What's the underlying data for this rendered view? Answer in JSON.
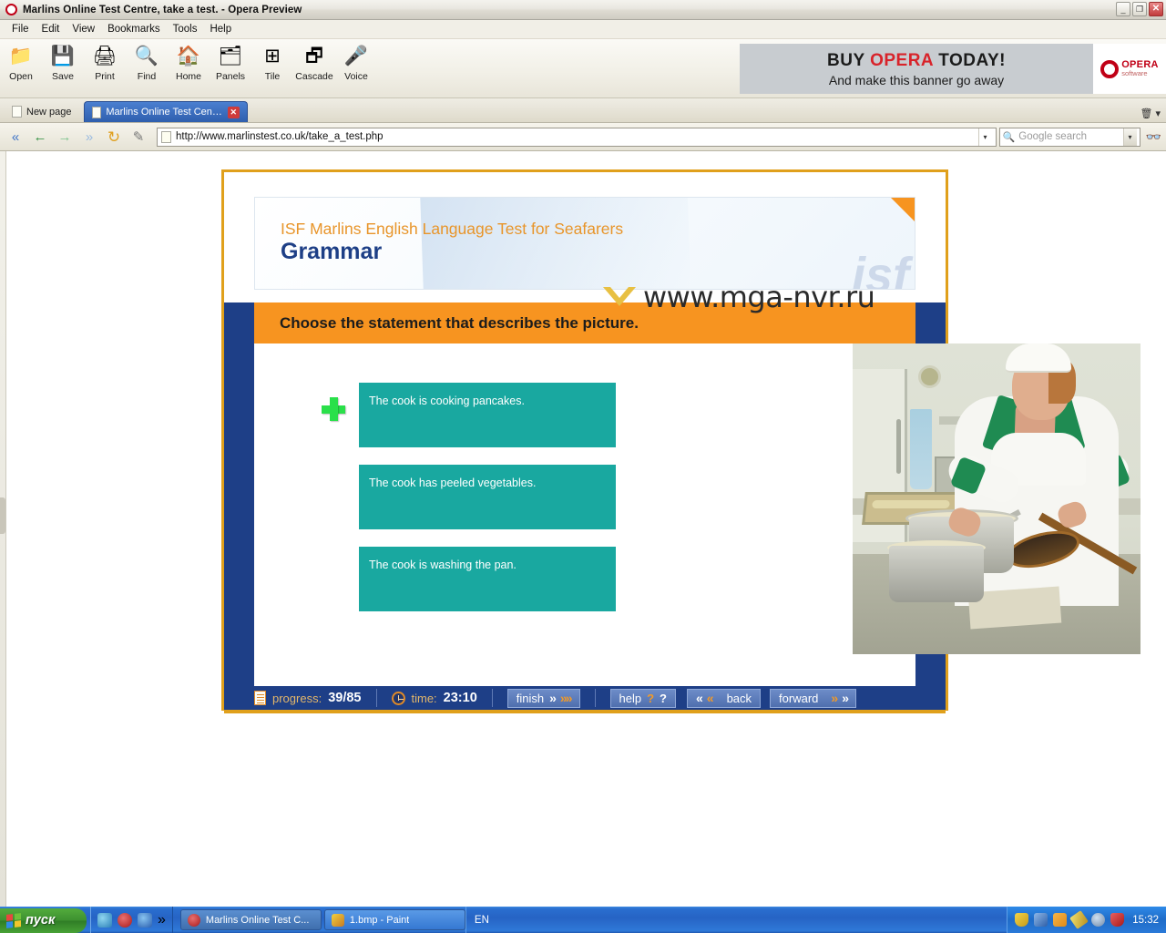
{
  "window": {
    "title": "Marlins Online Test Centre, take a test. - Opera Preview",
    "app_icon": "opera-icon",
    "minimize": "_",
    "restore": "❐",
    "close": "✕"
  },
  "menubar": {
    "items": [
      "File",
      "Edit",
      "View",
      "Bookmarks",
      "Tools",
      "Help"
    ]
  },
  "toolbar": {
    "buttons": [
      {
        "label": "Open",
        "icon": "folder-icon",
        "glyph": "📁"
      },
      {
        "label": "Save",
        "icon": "floppy-icon",
        "glyph": "💾"
      },
      {
        "label": "Print",
        "icon": "printer-icon",
        "glyph": "🖨"
      },
      {
        "label": "Find",
        "icon": "magnifier-icon",
        "glyph": "🔍"
      },
      {
        "label": "Home",
        "icon": "home-icon",
        "glyph": "🏠"
      },
      {
        "label": "Panels",
        "icon": "panels-icon",
        "glyph": "🗂"
      },
      {
        "label": "Tile",
        "icon": "tile-icon",
        "glyph": "⊞"
      },
      {
        "label": "Cascade",
        "icon": "cascade-icon",
        "glyph": "🗗"
      },
      {
        "label": "Voice",
        "icon": "voice-icon",
        "glyph": "🎤"
      }
    ]
  },
  "banner": {
    "line1_a": "BUY ",
    "line1_b": "OPERA",
    "line1_c": " TODAY!",
    "line2": "And make this banner go away",
    "logo_title": "OPERA",
    "logo_sub": "software"
  },
  "tabs": {
    "new_page_label": "New page",
    "active_label": "Marlins Online Test Centr...",
    "close_glyph": "✕",
    "trash_icon": "trash-icon",
    "trash_chevron": "▾"
  },
  "addressbar": {
    "back_fast": "«",
    "back": "←",
    "forward": "→",
    "forward_fast": "»",
    "reload": "↻",
    "edit": "✎",
    "url": "http://www.marlinstest.co.uk/take_a_test.php",
    "dropdown_glyph": "▾",
    "search_placeholder": "Google search",
    "search_value": "",
    "glasses_icon": "glasses-icon"
  },
  "test": {
    "header_subtitle": "ISF Marlins English Language Test for Seafarers",
    "header_title": "Grammar",
    "watermark_logo": "isf",
    "question": "Choose the statement that describes the picture.",
    "selected_marker": "plus-icon",
    "options": [
      "The cook is cooking pancakes.",
      "The cook has peeled vegetables.",
      "The cook is washing the pan."
    ],
    "photo_alt": "cook-frying-pancakes-photo",
    "footer": {
      "progress_label": "progress:",
      "progress_value": "39/85",
      "time_label": "time:",
      "time_value": "23:10",
      "finish_label": "finish",
      "finish_arrows": "»»",
      "help_label": "help",
      "help_marks_a": "?",
      "help_marks_b": "?",
      "back_arrows": "«",
      "back_label": "back",
      "forward_label": "forward",
      "forward_arrows": "»"
    }
  },
  "overlay_watermark": {
    "text": "www.mga-nvr.ru",
    "chevron_icon": "chevron-down-icon",
    "chevron_color": "#e8c043"
  },
  "taskbar": {
    "start_label": "пуск",
    "quicklaunch_chevron": "»",
    "tasks": [
      {
        "label": "Marlins Online Test C...",
        "state": "active",
        "icon": "opera-icon"
      },
      {
        "label": "1.bmp - Paint",
        "state": "inactive",
        "icon": "paint-icon"
      }
    ],
    "language": "EN",
    "clock": "15:32",
    "tray_icons": [
      "shield-icon",
      "network-icon",
      "folder-icon",
      "pencil-icon",
      "clock-icon",
      "security-alert-icon"
    ]
  },
  "colors": {
    "frame_orange": "#e0a01c",
    "question_orange": "#f79420",
    "option_teal": "#19a8a0",
    "deep_blue": "#1e3f87",
    "title_blue": "#1d3f86",
    "subtitle_orange": "#e8952a",
    "plus_green": "#2ae04a"
  }
}
